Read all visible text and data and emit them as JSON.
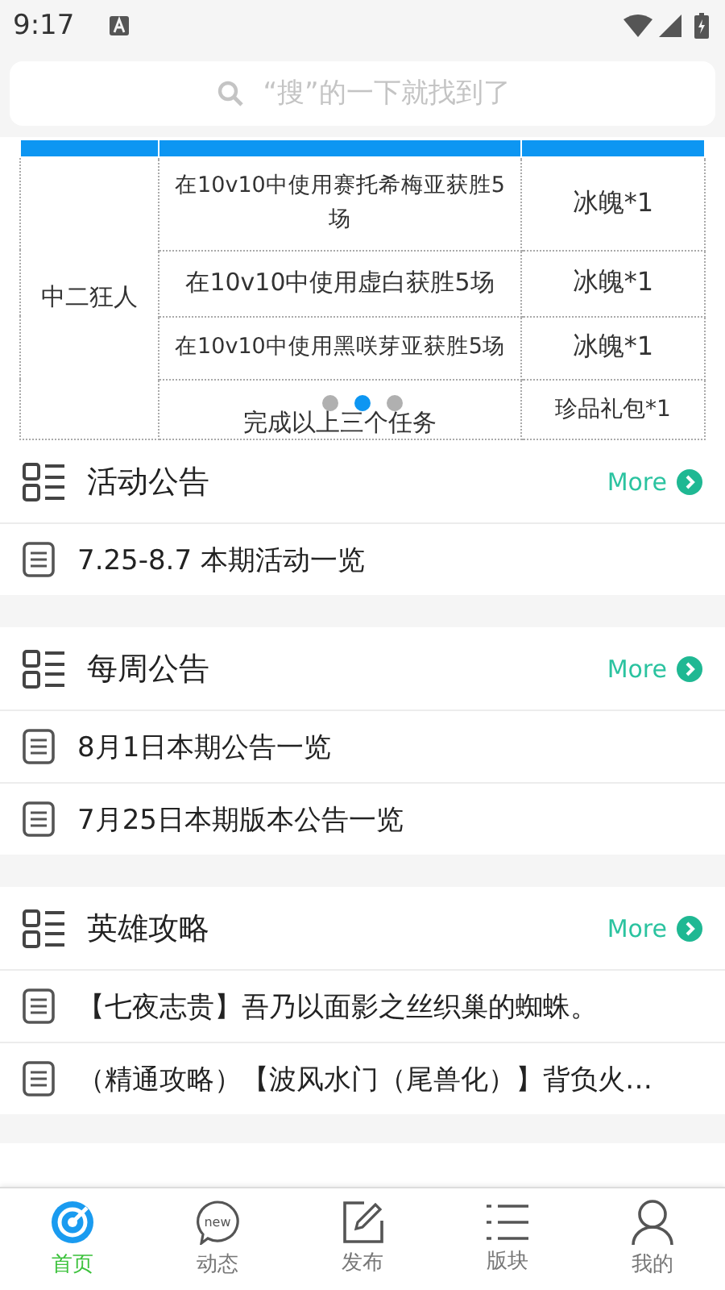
{
  "status_bar": {
    "time": "9:17"
  },
  "search": {
    "placeholder": "“搜”的一下就找到了"
  },
  "banner": {
    "table": {
      "group": "中二狂人",
      "rows": [
        {
          "task": "在10v10中使用赛托希梅亚获胜5场",
          "reward": "冰魄*1"
        },
        {
          "task": "在10v10中使用虚白获胜5场",
          "reward": "冰魄*1"
        },
        {
          "task": "在10v10中使用黑咲芽亚获胜5场",
          "reward": "冰魄*1"
        },
        {
          "task": "完成以上三个任务",
          "reward": "珍品礼包*1"
        }
      ]
    },
    "dots": [
      {
        "selected": false
      },
      {
        "selected": true
      },
      {
        "selected": false
      }
    ]
  },
  "sections": [
    {
      "title": "活动公告",
      "more": "More",
      "items": [
        "7.25-8.7 本期活动一览"
      ]
    },
    {
      "title": "每周公告",
      "more": "More",
      "items": [
        "8月1日本期公告一览",
        "7月25日本期版本公告一览"
      ]
    },
    {
      "title": "英雄攻略",
      "more": "More",
      "items": [
        "【七夜志贵】吾乃以面影之丝织巢的蜘蛛。",
        "（精通攻略）【波风水门（尾兽化）】背负火…"
      ]
    }
  ],
  "tab_bar": [
    {
      "kind": "home",
      "label": "首页",
      "selected": true
    },
    {
      "kind": "news",
      "label": "动态",
      "icon_text": "new",
      "selected": false
    },
    {
      "kind": "post",
      "label": "发布",
      "selected": false
    },
    {
      "kind": "boards",
      "label": "版块",
      "selected": false
    },
    {
      "kind": "me",
      "label": "我的",
      "selected": false
    }
  ]
}
